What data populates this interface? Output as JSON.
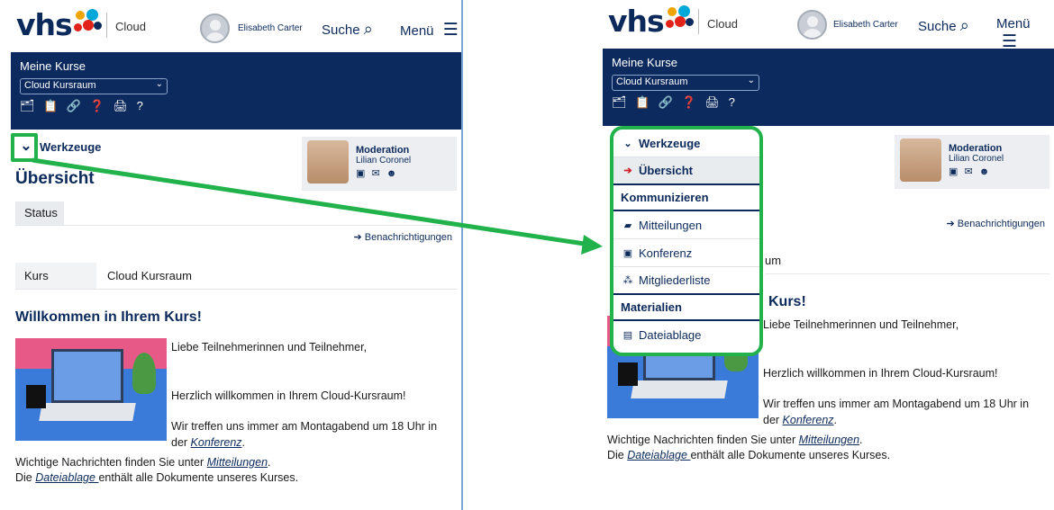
{
  "header": {
    "logo": "vhs",
    "cloud": "Cloud",
    "user": "Elisabeth Carter",
    "search": "Suche",
    "menu": "Menü"
  },
  "blue": {
    "title": "Meine Kurse",
    "select": "Cloud Kursraum",
    "icons": "🗂 📋 🔗 ❓ 🖨 ?"
  },
  "tools": {
    "label": "Werkzeuge"
  },
  "moderation": {
    "title": "Moderation",
    "name": "Lilian Coronel",
    "icons": "▣ ✉ ☻"
  },
  "page": {
    "title": "Übersicht",
    "status_tab": "Status",
    "notifications": "➔ Benachrichtigungen",
    "kurs_label": "Kurs",
    "kurs_value": "Cloud Kursraum",
    "welcome": "Willkommen in Ihrem Kurs!",
    "welcome_partial": "Kurs!",
    "kurs_value_partial": "um"
  },
  "body": {
    "greeting": "Liebe Teilnehmerinnen und Teilnehmer,",
    "line2": "Herzlich willkommen in Ihrem Cloud-Kursraum!",
    "line3a": "Wir treffen uns immer am Montagabend um 18 Uhr in",
    "line3b_pre": "der ",
    "link_konferenz": "Konferenz",
    "line4_pre": "Wichtige Nachrichten finden Sie unter ",
    "link_mitteilungen": "Mitteilungen",
    "line5_pre": "Die ",
    "link_dateiablage": "Dateiablage ",
    "line5_post": "enthält alle Dokumente unseres Kurses."
  },
  "drawer": {
    "items": [
      {
        "label": "Werkzeuge",
        "icon": "✓"
      },
      {
        "label": "Übersicht",
        "icon": "➔"
      },
      {
        "label": "Kommunizieren"
      },
      {
        "label": "Mitteilungen",
        "icon": "▰"
      },
      {
        "label": "Konferenz",
        "icon": "▣"
      },
      {
        "label": "Mitgliederliste",
        "icon": "⁂"
      },
      {
        "label": "Materialien"
      },
      {
        "label": "Dateiablage",
        "icon": "▤"
      }
    ]
  },
  "colors": {
    "navy": "#0c2a5e",
    "highlight": "#22b24c"
  }
}
